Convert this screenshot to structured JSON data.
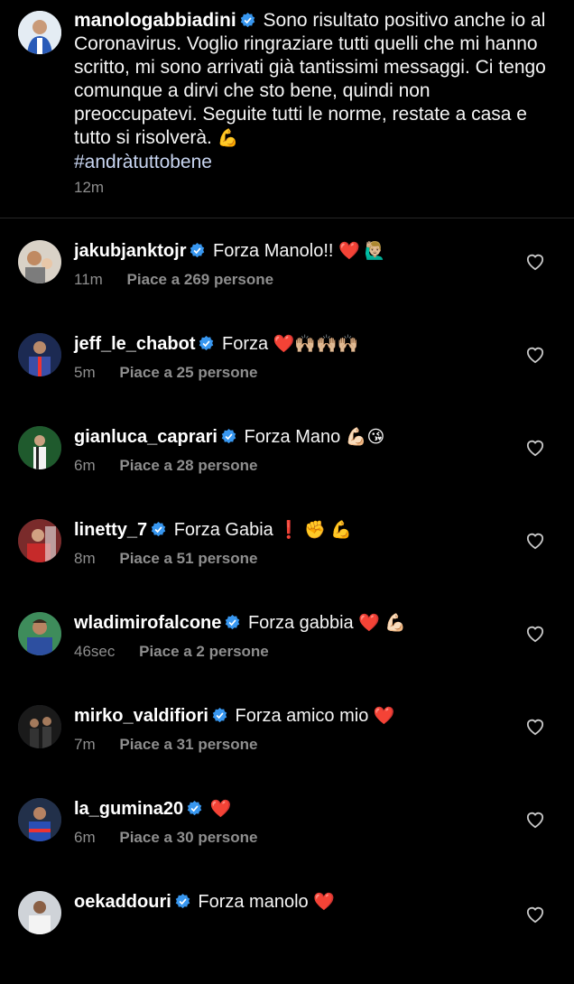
{
  "post": {
    "username": "manologabbiadini",
    "text": "Sono risultato positivo anche io al Coronavirus. Voglio ringraziare tutti quelli che mi hanno scritto, mi sono arrivati già tantissimi messaggi. Ci tengo comunque a dirvi che sto bene, quindi non preoccupatevi. Seguite tutti le norme, restate a casa e tutto si risolverà.",
    "emoji": "💪",
    "hashtag": "#andràtuttobene",
    "time": "12m"
  },
  "comments": [
    {
      "username": "jakubjanktojr",
      "text": "Forza Manolo!!",
      "emoji": "❤️ 🙋🏼‍♂️",
      "time": "11m",
      "likes": "Piace a 269 persone"
    },
    {
      "username": "jeff_le_chabot",
      "text": "Forza",
      "emoji": "❤️🙌🏼🙌🏼🙌🏼",
      "time": "5m",
      "likes": "Piace a 25 persone"
    },
    {
      "username": "gianluca_caprari",
      "text": "Forza Mano",
      "emoji": "💪🏻😘",
      "time": "6m",
      "likes": "Piace a 28 persone"
    },
    {
      "username": "linetty_7",
      "text": "Forza Gabia",
      "emoji": "❗ ✊ 💪",
      "time": "8m",
      "likes": "Piace a 51 persone"
    },
    {
      "username": "wladimirofalcone",
      "text": "Forza gabbia",
      "emoji": "❤️ 💪🏻",
      "time": "46sec",
      "likes": "Piace a 2 persone"
    },
    {
      "username": "mirko_valdifiori",
      "text": "Forza amico mio",
      "emoji": "❤️",
      "time": "7m",
      "likes": "Piace a 31 persone"
    },
    {
      "username": "la_gumina20",
      "text": "",
      "emoji": "❤️",
      "time": "6m",
      "likes": "Piace a 30 persone"
    },
    {
      "username": "oekaddouri",
      "text": "Forza manolo",
      "emoji": "❤️",
      "time": "",
      "likes": ""
    }
  ],
  "colors": {
    "background": "#000000",
    "verified": "#3897f0",
    "meta": "#8e8e8e"
  },
  "icons": {
    "verified": "verified-badge-icon",
    "like": "heart-outline-icon"
  }
}
